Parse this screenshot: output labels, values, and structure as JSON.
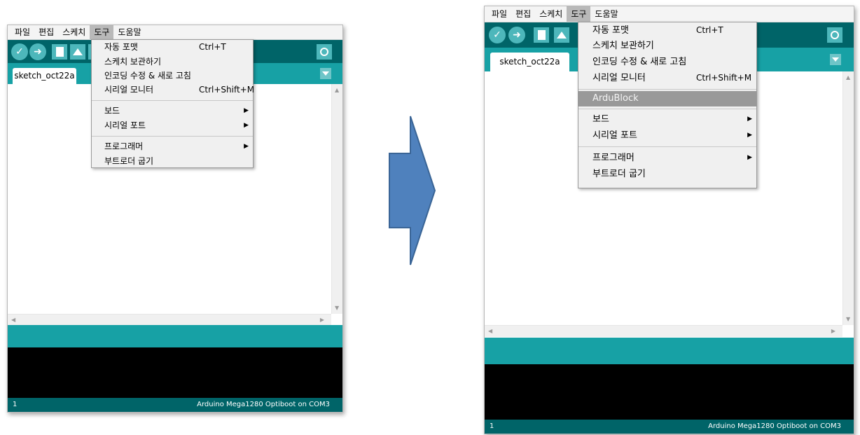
{
  "menubar": [
    "파일",
    "편집",
    "스케치",
    "도구",
    "도움말"
  ],
  "active_menu": "도구",
  "tab_label": "sketch_oct22a",
  "status": {
    "line": "1",
    "board": "Arduino Mega1280 Optiboot on COM3"
  },
  "before_menu": {
    "group1": [
      {
        "label": "자동 포맷",
        "shortcut": "Ctrl+T"
      },
      {
        "label": "스케치 보관하기",
        "shortcut": ""
      },
      {
        "label": "인코딩 수정 & 새로 고침",
        "shortcut": ""
      },
      {
        "label": "시리얼 모니터",
        "shortcut": "Ctrl+Shift+M"
      }
    ],
    "group2": [
      {
        "label": "보드",
        "submenu": true
      },
      {
        "label": "시리얼 포트",
        "submenu": true
      }
    ],
    "group3": [
      {
        "label": "프로그래머",
        "submenu": true
      },
      {
        "label": "부트로더 굽기",
        "submenu": false
      }
    ]
  },
  "after_menu": {
    "group1": [
      {
        "label": "자동 포맷",
        "shortcut": "Ctrl+T"
      },
      {
        "label": "스케치 보관하기",
        "shortcut": ""
      },
      {
        "label": "인코딩 수정 & 새로 고침",
        "shortcut": ""
      },
      {
        "label": "시리얼 모니터",
        "shortcut": "Ctrl+Shift+M"
      }
    ],
    "highlight": "ArduBlock",
    "group2": [
      {
        "label": "보드",
        "submenu": true
      },
      {
        "label": "시리얼 포트",
        "submenu": true
      }
    ],
    "group3": [
      {
        "label": "프로그래머",
        "submenu": true
      },
      {
        "label": "부트로더 굽기",
        "submenu": false
      }
    ]
  },
  "icons": {
    "verify": "checkmark-icon",
    "upload": "right-arrow-icon",
    "new": "new-file-icon",
    "open": "open-upload-icon",
    "serial": "magnifier-icon",
    "submenu": "submenu-arrow-icon",
    "transition": "right-arrow-shape"
  },
  "colors": {
    "toolbar": "#006468",
    "accent": "#17a1a5",
    "highlight": "#999999",
    "transition_arrow": "#4f81bd"
  }
}
